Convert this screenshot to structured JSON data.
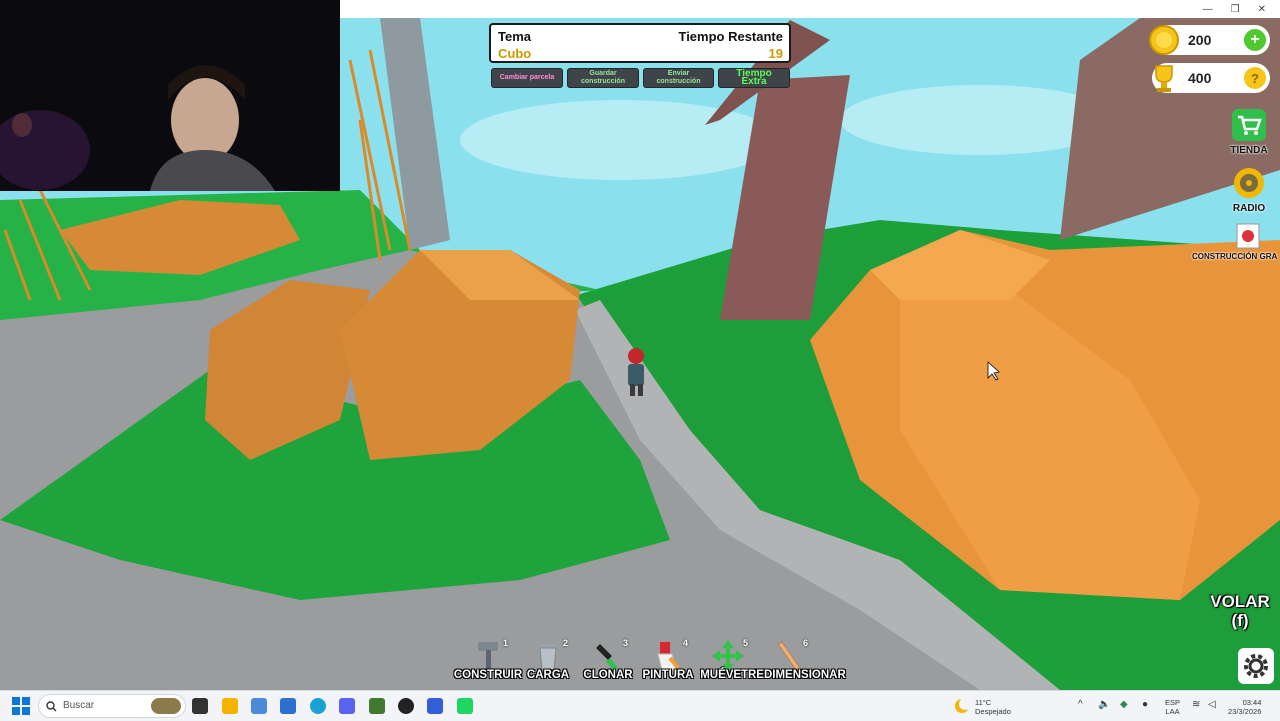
{
  "hud": {
    "theme_label": "Tema",
    "theme_value": "Cubo",
    "time_label": "Tiempo Restante",
    "time_value": "19",
    "buttons": {
      "change_plot": "Cambiar parcela",
      "save_build": "Guardar construcción",
      "submit_build": "Enviar construcción",
      "extra_time": "Tiempo Extra"
    }
  },
  "stats": {
    "coins": "200",
    "trophies": "400"
  },
  "side_menu": {
    "shop": "TIENDA",
    "radio": "RADIO",
    "big_build": "CONSTRUCCIÓN GRA"
  },
  "fly": {
    "label": "VOLAR",
    "key": "(f)"
  },
  "toolbar": [
    {
      "num": "1",
      "label": "CONSTRUIR",
      "icon": "hammer-icon"
    },
    {
      "num": "2",
      "label": "CARGA",
      "icon": "trash-can-icon"
    },
    {
      "num": "3",
      "label": "CLONAR",
      "icon": "clone-icon"
    },
    {
      "num": "4",
      "label": "PINTURA",
      "icon": "paint-icon"
    },
    {
      "num": "5",
      "label": "MUÉVETE",
      "icon": "move-arrows-icon"
    },
    {
      "num": "6",
      "label": "REDIMENSIONAR",
      "icon": "resize-icon"
    }
  ],
  "taskbar": {
    "search_placeholder": "Buscar",
    "weather_temp": "11°C",
    "weather_desc": "Despejado",
    "lang_1": "ESP",
    "lang_2": "LAA",
    "time": "03:44",
    "date": "23/3/2026"
  },
  "colors": {
    "grass": "#1fa33c",
    "path": "#8f9192",
    "rock": "#e89a3c",
    "sky": "#87dceb",
    "coin": "#f5c518",
    "plus_button": "#4fc92e"
  }
}
